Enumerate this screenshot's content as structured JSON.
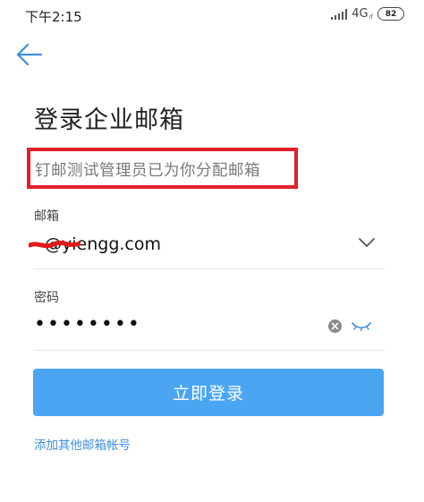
{
  "status_bar": {
    "time": "下午2:15",
    "network": "4G",
    "network_sub": "ıf",
    "battery": "82"
  },
  "page": {
    "title": "登录企业邮箱",
    "hint": "钉邮测试管理员已为你分配邮箱"
  },
  "email_field": {
    "label": "邮箱",
    "value": "@yiengg.com"
  },
  "password_field": {
    "label": "密码",
    "value": "••••••••"
  },
  "login_button": {
    "label": "立即登录"
  },
  "add_account_link": {
    "label": "添加其他邮箱帐号"
  },
  "colors": {
    "accent": "#4aa5f3",
    "link": "#3d8fe0",
    "highlight_box": "#e1202a",
    "redaction": "#e11a1a"
  },
  "icons": [
    "back-arrow-icon",
    "signal-icon",
    "battery-icon",
    "chevron-down-icon",
    "clear-icon",
    "eye-closed-icon"
  ]
}
